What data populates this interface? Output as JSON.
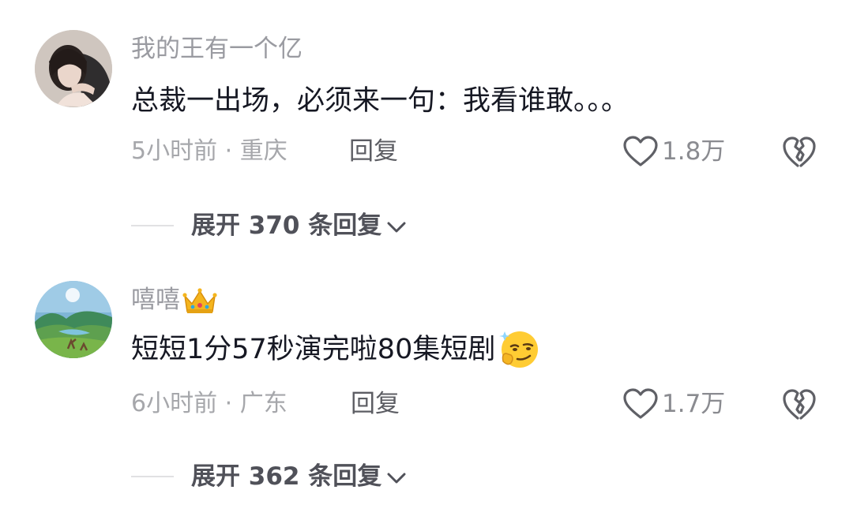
{
  "comments": [
    {
      "username": "我的王有一个亿",
      "text": "总裁一出场，必须来一句：我看谁敢。。。",
      "time_location": "5小时前 · 重庆",
      "reply_label": "回复",
      "likes": "1.8万",
      "expand_label": "展开 370 条回复"
    },
    {
      "username": "嘻嘻",
      "text": "短短1分57秒演完啦80集短剧",
      "time_location": "6小时前 · 广东",
      "reply_label": "回复",
      "likes": "1.7万",
      "expand_label": "展开 362 条回复",
      "username_badge": "crown-icon",
      "text_emoji": "smirk-emoji-icon"
    }
  ],
  "colors": {
    "text": "#161823",
    "secondary": "#a6a7ab",
    "expand": "#505159"
  }
}
